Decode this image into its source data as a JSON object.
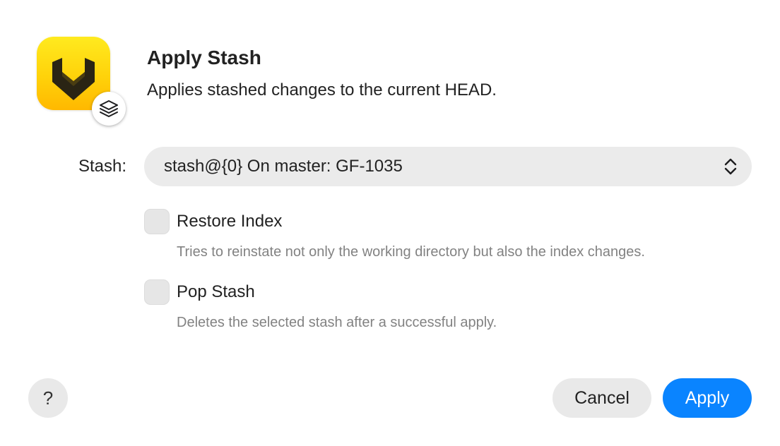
{
  "dialog": {
    "title": "Apply Stash",
    "subtitle": "Applies stashed changes to the current HEAD.",
    "app_icon": "app-logo-icon",
    "badge_icon": "layers-icon"
  },
  "stash": {
    "label": "Stash:",
    "value": "stash@{0} On master: GF-1035",
    "control_icon": "up-down-chevron-icon"
  },
  "options": [
    {
      "label": "Restore Index",
      "description": "Tries to reinstate not only the working directory but also the index changes.",
      "checked": false
    },
    {
      "label": "Pop Stash",
      "description": "Deletes the selected stash after a successful apply.",
      "checked": false
    }
  ],
  "buttons": {
    "help": "?",
    "cancel": "Cancel",
    "apply": "Apply"
  },
  "colors": {
    "accent": "#0a84ff",
    "icon_yellow": "#ffd20a",
    "control_bg": "#ebebeb"
  }
}
